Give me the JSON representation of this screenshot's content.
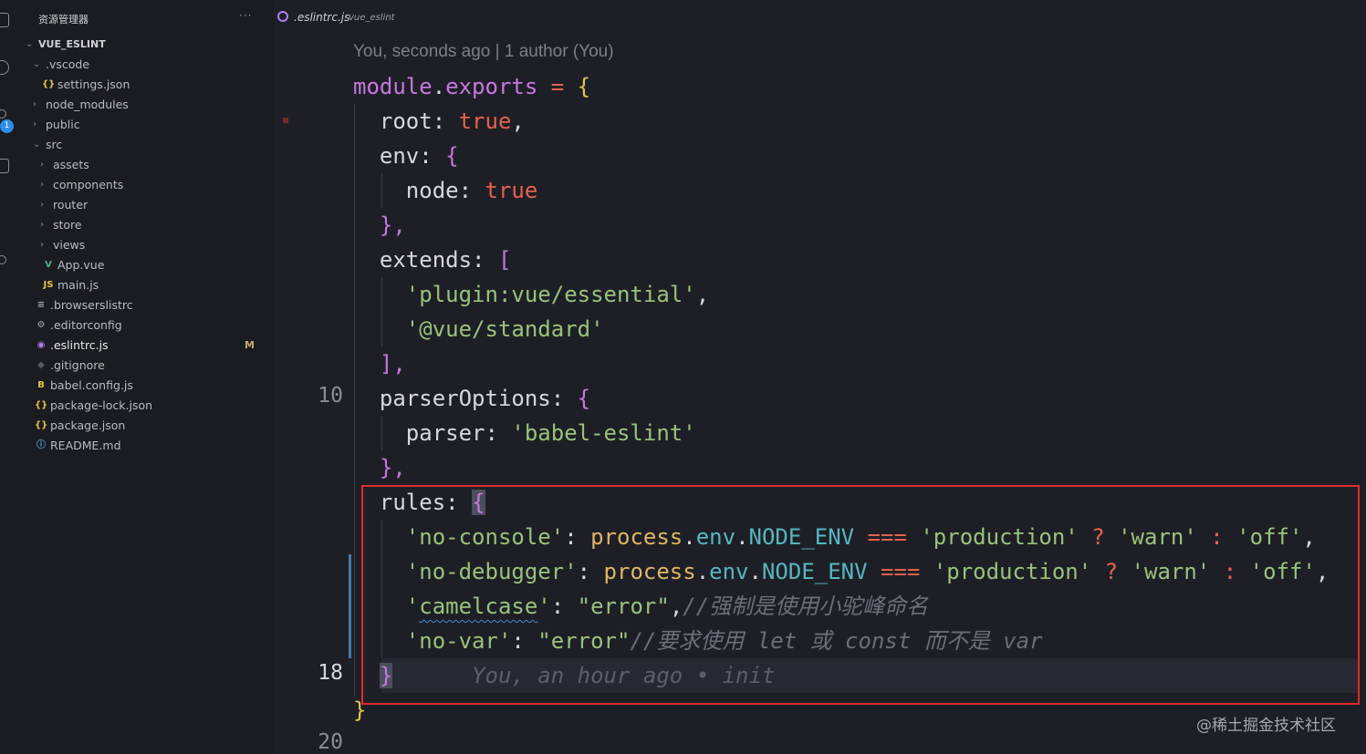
{
  "activity_bar": {
    "icons": [
      "explorer-icon",
      "search-icon",
      "source-control-icon",
      "extensions-icon",
      "run-icon",
      "remote-icon"
    ],
    "source_control_badge": "1"
  },
  "sidebar": {
    "title": "资源管理器",
    "more": "···",
    "tree": [
      {
        "label": "VUE_ESLINT",
        "chev": "v",
        "icon": "",
        "level": 0,
        "root": true
      },
      {
        "label": ".vscode",
        "chev": "v",
        "icon": "",
        "level": 1
      },
      {
        "label": "settings.json",
        "chev": "",
        "icon": "{}",
        "icon_color": "#e7c34a",
        "level": 2
      },
      {
        "label": "node_modules",
        "chev": ">",
        "icon": "",
        "level": 1
      },
      {
        "label": "public",
        "chev": ">",
        "icon": "",
        "level": 1
      },
      {
        "label": "src",
        "chev": "v",
        "icon": "",
        "level": 1
      },
      {
        "label": "assets",
        "chev": ">",
        "icon": "",
        "level": 2
      },
      {
        "label": "components",
        "chev": ">",
        "icon": "",
        "level": 2
      },
      {
        "label": "router",
        "chev": ">",
        "icon": "",
        "level": 2
      },
      {
        "label": "store",
        "chev": ">",
        "icon": "",
        "level": 2
      },
      {
        "label": "views",
        "chev": ">",
        "icon": "",
        "level": 2
      },
      {
        "label": "App.vue",
        "chev": "",
        "icon": "V",
        "icon_color": "#41b883",
        "level": 2
      },
      {
        "label": "main.js",
        "chev": "",
        "icon": "JS",
        "icon_color": "#e7c34a",
        "level": 2
      },
      {
        "label": ".browserslistrc",
        "chev": "",
        "icon": "≡",
        "icon_color": "#a9acb7",
        "level": 1
      },
      {
        "label": ".editorconfig",
        "chev": "",
        "icon": "⚙",
        "icon_color": "#a9acb7",
        "level": 1
      },
      {
        "label": ".eslintrc.js",
        "chev": "",
        "icon": "◉",
        "icon_color": "#b47cf0",
        "level": 1,
        "active": true,
        "status": "M"
      },
      {
        "label": ".gitignore",
        "chev": "",
        "icon": "◆",
        "icon_color": "#5a5d68",
        "level": 1
      },
      {
        "label": "babel.config.js",
        "chev": "",
        "icon": "B",
        "icon_color": "#e7c34a",
        "level": 1
      },
      {
        "label": "package-lock.json",
        "chev": "",
        "icon": "{}",
        "icon_color": "#e7c34a",
        "level": 1
      },
      {
        "label": "package.json",
        "chev": "",
        "icon": "{}",
        "icon_color": "#e7c34a",
        "level": 1
      },
      {
        "label": "README.md",
        "chev": "",
        "icon": "ⓘ",
        "icon_color": "#4aa3df",
        "level": 1
      }
    ]
  },
  "breadcrumb": {
    "file": ".eslintrc.js",
    "project": "vue_eslint"
  },
  "editor": {
    "blame_header": "You, seconds ago | 1 author (You)",
    "line_numbers": {
      "l10": "10",
      "l18": "18",
      "l20": "20"
    },
    "inline_blame": "You, an hour ago • init",
    "watermark": "@稀土掘金技术社区",
    "tokens": {
      "module": "module",
      "dot": ".",
      "exports": "exports",
      "eq": " = ",
      "lbrace": "{",
      "rbrace": "}",
      "root_key": "root: ",
      "true": "true",
      "comma": ",",
      "env_key": "env: ",
      "node_key": "node: ",
      "close_brace_comma": "},",
      "extends_key": "extends: ",
      "lbracket": "[",
      "ext1": "'plugin:vue/essential'",
      "ext2": "'@vue/standard'",
      "close_bracket_comma": "],",
      "parser_options_key": "parserOptions: ",
      "parser_key": "parser: ",
      "parser_val": "'babel-eslint'",
      "rules_key": "rules: ",
      "no_console": "'no-console'",
      "no_debugger": "'no-debugger'",
      "colon": ": ",
      "process": "process",
      "env": "env",
      "node_env": "NODE_ENV",
      "strict_eq": " === ",
      "production": "'production'",
      "q": " ? ",
      "warn": "'warn'",
      "colon_sep": " : ",
      "off": "'off'",
      "camel_q1": "'",
      "camelcase": "camelcase",
      "camel_q2": "'",
      "error": "\"error\"",
      "camel_comment": "//强制是使用小驼峰命名",
      "no_var": "'no-var'",
      "var_comment": "//要求使用 let 或 const 而不是 var"
    }
  }
}
